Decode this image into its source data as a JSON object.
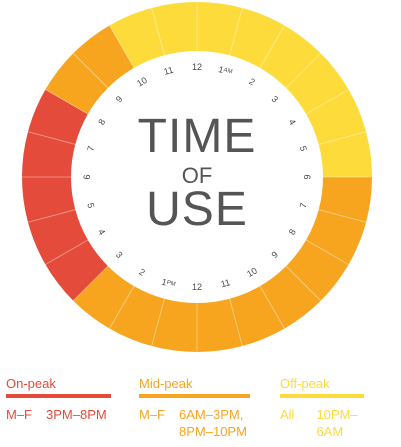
{
  "center_title": {
    "line1": "TIME",
    "line2": "OF",
    "line3": "USE"
  },
  "colors": {
    "on_peak": "#e54b3a",
    "mid_peak": "#f7a51e",
    "off_peak": "#fddb3a",
    "divider": "#ffffff",
    "hour_text": "#4a4a4a",
    "title_text": "#555555"
  },
  "clock": {
    "hours": [
      "12",
      "1",
      "2",
      "3",
      "4",
      "5",
      "6",
      "7",
      "8",
      "9",
      "10",
      "11",
      "12",
      "1",
      "2",
      "3",
      "4",
      "5",
      "6",
      "7",
      "8",
      "9",
      "10",
      "11"
    ],
    "am_marker": "AM",
    "pm_marker": "PM",
    "segments": [
      "off_peak",
      "off_peak",
      "off_peak",
      "off_peak",
      "off_peak",
      "off_peak",
      "mid_peak",
      "mid_peak",
      "mid_peak",
      "mid_peak",
      "mid_peak",
      "mid_peak",
      "mid_peak",
      "mid_peak",
      "mid_peak",
      "on_peak",
      "on_peak",
      "on_peak",
      "on_peak",
      "on_peak",
      "mid_peak",
      "mid_peak",
      "off_peak",
      "off_peak"
    ]
  },
  "legend": {
    "on_peak": {
      "label": "On-peak",
      "days": "M–F",
      "times": "3PM–8PM"
    },
    "mid_peak": {
      "label": "Mid-peak",
      "days": "M–F",
      "times": "6AM–3PM,\n8PM–10PM"
    },
    "off_peak": {
      "label": "Off-peak",
      "days": "All",
      "times": "10PM–6AM"
    }
  }
}
